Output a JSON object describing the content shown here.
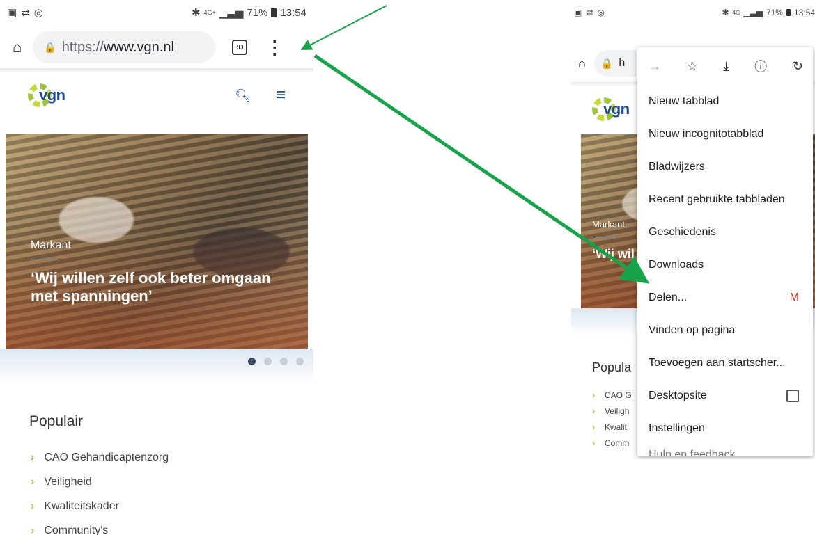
{
  "left_phone": {
    "status_time": "13:54",
    "status_battery": "71%",
    "status_network": "4G+",
    "url_scheme": "https://",
    "url_host": "www.vgn.nl",
    "tab_count": ":D",
    "logo_text": "vgn",
    "hero_label": "Markant",
    "hero_title": "‘Wij willen zelf ook beter omgaan met spanningen’",
    "carousel_slides": 4,
    "carousel_active": 1,
    "popular_title": "Populair",
    "popular_items": [
      "CAO Gehandicaptenzorg",
      "Veiligheid",
      "Kwaliteitskader",
      "Community's"
    ]
  },
  "right_phone": {
    "status_time": "13:54",
    "status_battery": "71%",
    "status_network": "4G",
    "url_partial": "h",
    "logo_text": "vgn",
    "hero_label": "Markant",
    "hero_title": "‘Wij wil omgaa",
    "popular_title": "Popula",
    "popular_items": [
      "CAO G",
      "Veiligh",
      "Kwalit",
      "Comm"
    ],
    "menu": {
      "top_icons": [
        "forward-icon",
        "star-icon",
        "download-icon",
        "info-icon",
        "reload-icon"
      ],
      "items": [
        "Nieuw tabblad",
        "Nieuw incognitotabblad",
        "Bladwijzers",
        "Recent gebruikte tabbladen",
        "Geschiedenis",
        "Downloads",
        "Delen...",
        "Vinden op pagina",
        "Toevoegen aan startscher...",
        "Desktopsite",
        "Instellingen",
        "Hulp en feedback"
      ],
      "share_icon": "gmail-icon",
      "desktop_checked": false
    }
  },
  "annotation": {
    "arrow_color": "#16a34a"
  }
}
